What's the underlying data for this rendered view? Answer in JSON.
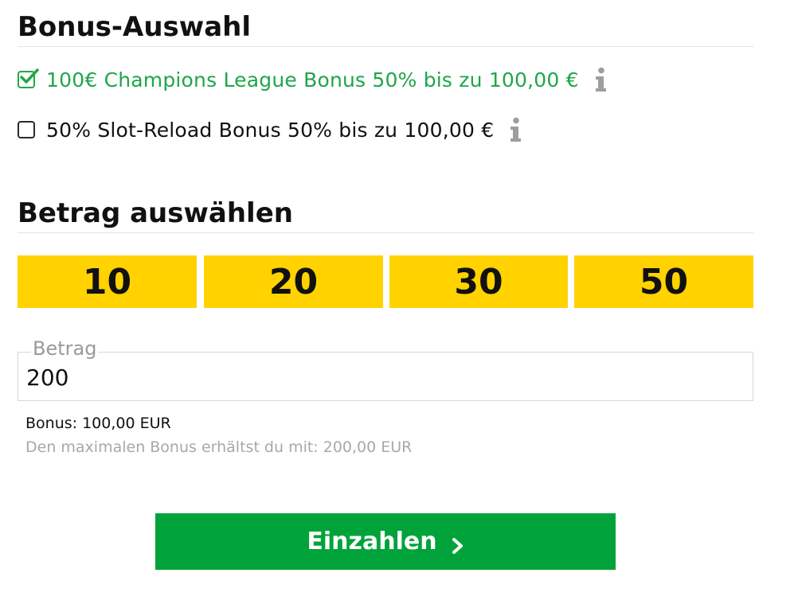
{
  "bonus_section": {
    "title": "Bonus-Auswahl",
    "options": [
      {
        "label": "100€ Champions League Bonus 50% bis zu 100,00 €",
        "selected": true,
        "icon": "info-icon"
      },
      {
        "label": "50% Slot-Reload Bonus 50% bis zu 100,00 €",
        "selected": false,
        "icon": "info-icon"
      }
    ]
  },
  "amount_section": {
    "title": "Betrag auswählen",
    "presets": [
      "10",
      "20",
      "30",
      "50"
    ],
    "field": {
      "legend": "Betrag",
      "value": "200"
    },
    "bonus_text": "Bonus: 100,00 EUR",
    "hint_text": "Den maximalen Bonus erhältst du mit: 200,00 EUR"
  },
  "submit": {
    "label": "Einzahlen",
    "icon": "chevron-right-icon"
  },
  "colors": {
    "accent_green": "#00a33a",
    "selected_text_green": "#1fa64a",
    "preset_yellow": "#ffd200",
    "muted_text": "#a8a8a8",
    "info_icon_gray": "#9e9e9e"
  }
}
